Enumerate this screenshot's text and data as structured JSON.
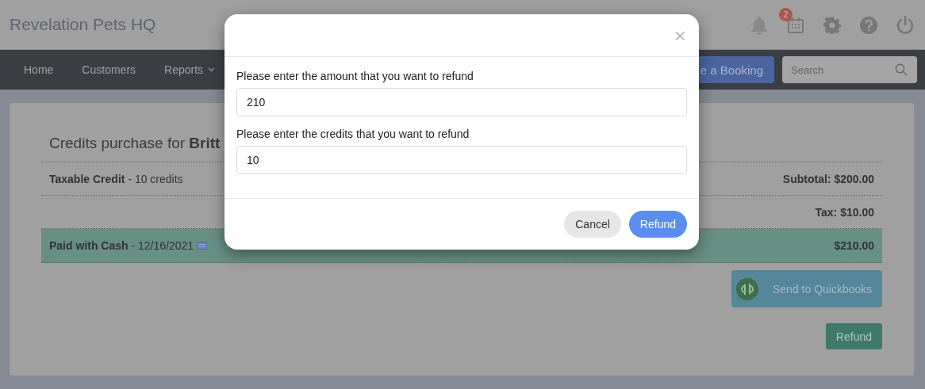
{
  "app_title": "Revelation Pets HQ",
  "header_icons": [
    {
      "kind": "bell"
    },
    {
      "kind": "calendar",
      "badge": "2"
    },
    {
      "kind": "gear"
    },
    {
      "kind": "help"
    },
    {
      "kind": "power"
    }
  ],
  "nav": [
    {
      "label": "Home",
      "dropdown": false
    },
    {
      "label": "Customers",
      "dropdown": false
    },
    {
      "label": "Reports",
      "dropdown": true
    }
  ],
  "book_button": "e a Booking",
  "search": {
    "placeholder": "Search"
  },
  "card": {
    "title": "Credits purchase for **Britt**",
    "rows": [
      {
        "kind": "item",
        "left": "**Taxable Credit** - 10 credits",
        "right": "Subtotal: $200.00"
      },
      {
        "kind": "tax",
        "left": "",
        "right": "Tax: $10.00"
      },
      {
        "kind": "payment",
        "left": "**Paid with Cash** - 12/16/2021",
        "right": "$210.00"
      }
    ],
    "quickbooks_button": "Send to Quickbooks",
    "refund_button": "Refund"
  },
  "modal": {
    "close": "×",
    "fields": [
      {
        "label": "Please enter the amount that you want to refund",
        "value": "210"
      },
      {
        "label": "Please enter the credits that you want to refund",
        "value": "10"
      }
    ],
    "buttons": [
      {
        "label": "Cancel",
        "kind": "secondary"
      },
      {
        "label": "Refund",
        "kind": "primary"
      }
    ]
  }
}
